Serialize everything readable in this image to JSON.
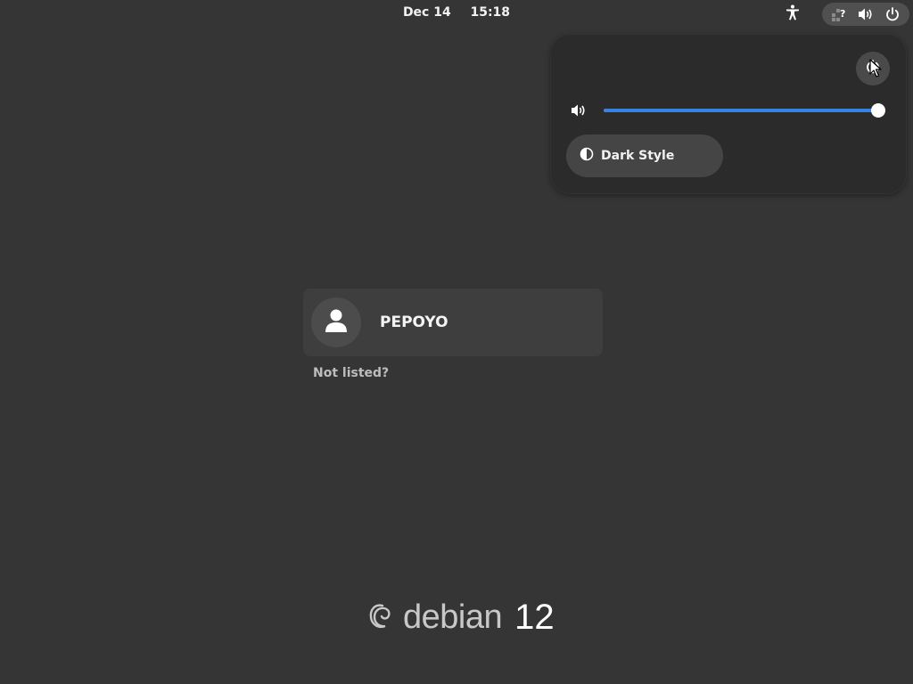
{
  "topbar": {
    "date": "Dec 14",
    "time": "15:18",
    "accessibility_icon": "accessibility-icon",
    "tray_icons": [
      "network-unknown-icon",
      "volume-icon",
      "power-icon"
    ]
  },
  "quick_settings": {
    "top_button_icon": "power-off-icon",
    "volume": {
      "icon": "volume-icon",
      "level": 1.0
    },
    "dark_style": {
      "label": "Dark Style",
      "icon": "dark-style-icon",
      "active": false
    }
  },
  "login": {
    "users": [
      {
        "name": "PEPOYO",
        "avatar_icon": "user-avatar-icon"
      }
    ],
    "not_listed_label": "Not listed?"
  },
  "branding": {
    "name": "debian",
    "version": "12",
    "logo_icon": "debian-swirl-icon"
  },
  "colors": {
    "background": "#353535",
    "accent": "#3584e4",
    "popup": "#2b2b2b"
  }
}
